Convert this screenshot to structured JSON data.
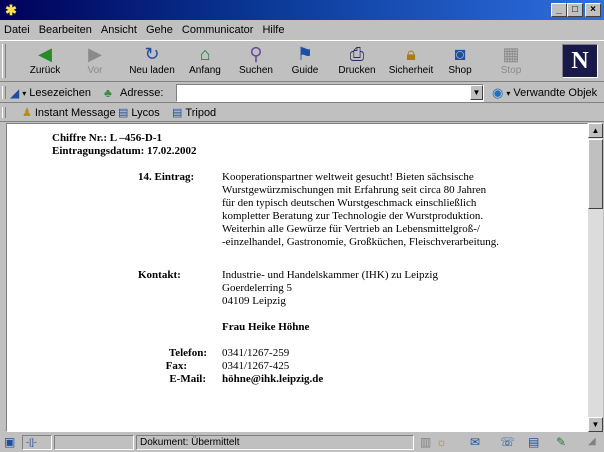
{
  "window": {
    "minimize": "_",
    "maximize": "□",
    "close": "×"
  },
  "menu": [
    "Datei",
    "Bearbeiten",
    "Ansicht",
    "Gehe",
    "Communicator",
    "Hilfe"
  ],
  "toolbar": {
    "back": "Zurück",
    "forward": "Vor",
    "reload": "Neu laden",
    "home": "Anfang",
    "search": "Suchen",
    "guide": "Guide",
    "print": "Drucken",
    "security": "Sicherheit",
    "shop": "Shop",
    "stop": "Stop",
    "logo": "N"
  },
  "location": {
    "bookmarks": "Lesezeichen",
    "address_label": "Adresse:",
    "address_value": "",
    "related": "Verwandte Objek"
  },
  "personal": [
    "Instant Message",
    "Lycos",
    "Tripod"
  ],
  "page": {
    "chiffre": "Chiffre Nr.: L –456-D-1",
    "date": "Eintragungsdatum: 17.02.2002",
    "entry_label": "14. Eintrag:",
    "entry_lines": [
      "Kooperationspartner weltweit gesucht! Bieten sächsische",
      "Wurstgewürzmischungen mit Erfahrung seit circa 80 Jahren",
      "für den typisch deutschen Wurstgeschmack einschließlich",
      "kompletter Beratung zur Technologie der Wurstproduktion.",
      "Weiterhin alle Gewürze für Vertrieb an Lebensmittelgroß-/",
      "-einzelhandel, Gastronomie, Großküchen, Fleischverarbeitung."
    ],
    "contact_label": "Kontakt:",
    "contact_lines": [
      "Industrie- und Handelskammer (IHK) zu Leipzig",
      "Goerdelerring 5",
      "04109 Leipzig"
    ],
    "contact_person": "Frau Heike Höhne",
    "phone_label": "Telefon:",
    "phone_value": "0341/1267-259",
    "fax_label": "Fax:",
    "fax_value": "0341/1267-425",
    "email_label": "E-Mail:",
    "email_value": "höhne@ihk.leipzig.de"
  },
  "status": {
    "text": "Dokument: Übermittelt"
  }
}
